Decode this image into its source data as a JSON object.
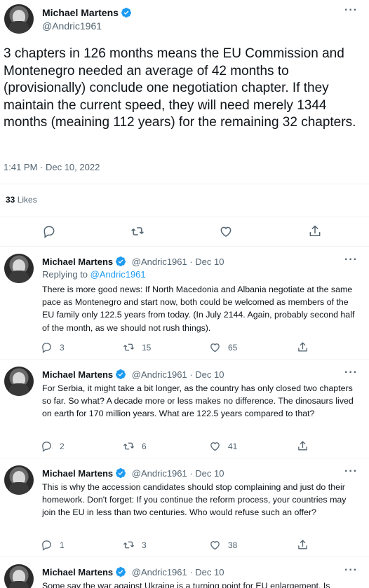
{
  "main": {
    "name": "Michael Martens",
    "handle": "@Andric1961",
    "text": "3 chapters in 126 months means the EU Commission and Montenegro needed an average of 42 months to (provisionally) conclude one negotiation chapter. If they maintain the current speed, they will need merely 1344 months (meaining 112 years) for the remaining 32 chapters.",
    "time": "1:41 PM · Dec 10, 2022",
    "likes_count": "33",
    "likes_label": "Likes"
  },
  "replies": [
    {
      "name": "Michael Martens",
      "meta": "@Andric1961 · Dec 10",
      "replying_prefix": "Replying to",
      "replying_handle": "@Andric1961",
      "text": "There is more good news: If North Macedonia and Albania negotiate at the same pace as Montenegro and start now, both could be welcomed as members of the EU family only 122.5 years  from today. (In July 2144. Again, probably second half of the month, as we should not rush things).",
      "replies": "3",
      "retweets": "15",
      "likes": "65"
    },
    {
      "name": "Michael Martens",
      "meta": "@Andric1961 · Dec 10",
      "text": "For Serbia, it might take a bit longer, as the country has only closed two chapters so far. So what? A decade more or less makes no difference. The dinosaurs lived on earth for 170 million years. What are 122.5 years compared to that?",
      "replies": "2",
      "retweets": "6",
      "likes": "41"
    },
    {
      "name": "Michael Martens",
      "meta": "@Andric1961 · Dec 10",
      "text": "This is why the accession candidates should stop complaining and just do their homework. Don't forget: If you continue the reform process, your countries may join the EU in less than two centuries. Who would refuse such an offer?",
      "replies": "1",
      "retweets": "3",
      "likes": "38"
    },
    {
      "name": "Michael Martens",
      "meta": "@Andric1961 · Dec 10",
      "text": "Some say the war against Ukraine is a turning point for EU enlargement. Is"
    }
  ],
  "colors": {
    "accent": "#1d9bf0",
    "text": "#0f1419",
    "muted": "#536471",
    "divider": "#eff3f4"
  },
  "icons": [
    "verified-badge-icon",
    "more-icon",
    "reply-icon",
    "retweet-icon",
    "like-icon",
    "share-icon"
  ]
}
